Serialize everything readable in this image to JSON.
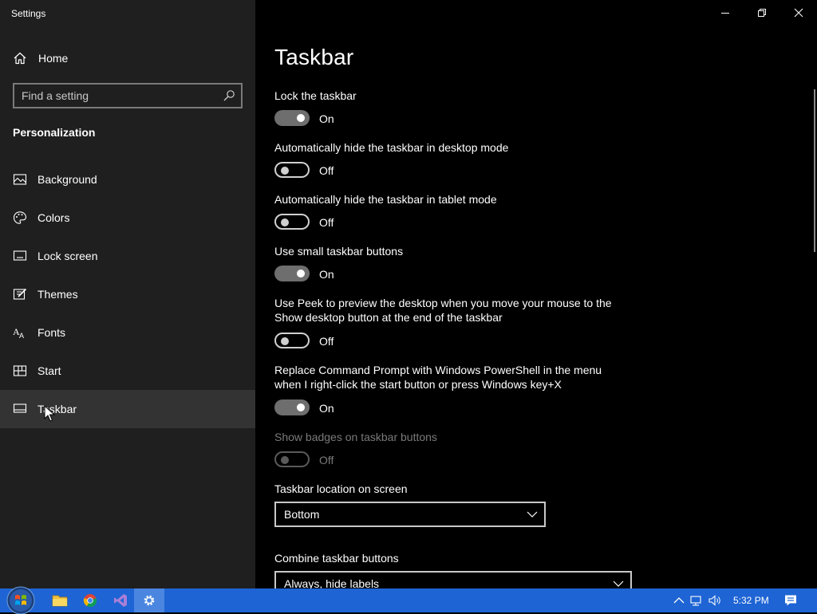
{
  "window": {
    "title": "Settings",
    "minimize_icon": "minimize-icon",
    "maximize_icon": "restore-icon",
    "close_icon": "close-icon"
  },
  "sidebar": {
    "home_label": "Home",
    "search": {
      "placeholder": "Find a setting",
      "icon": "search-icon"
    },
    "section_title": "Personalization",
    "items": [
      {
        "label": "Background",
        "icon": "image-icon"
      },
      {
        "label": "Colors",
        "icon": "palette-icon"
      },
      {
        "label": "Lock screen",
        "icon": "lock-screen-icon"
      },
      {
        "label": "Themes",
        "icon": "paintbrush-icon"
      },
      {
        "label": "Fonts",
        "icon": "font-icon"
      },
      {
        "label": "Start",
        "icon": "start-menu-icon"
      },
      {
        "label": "Taskbar",
        "icon": "taskbar-icon",
        "selected": true
      }
    ]
  },
  "main": {
    "title": "Taskbar",
    "settings": [
      {
        "label": "Lock the taskbar",
        "state": "On",
        "on": true
      },
      {
        "label": "Automatically hide the taskbar in desktop mode",
        "state": "Off",
        "on": false
      },
      {
        "label": "Automatically hide the taskbar in tablet mode",
        "state": "Off",
        "on": false
      },
      {
        "label": "Use small taskbar buttons",
        "state": "On",
        "on": true
      },
      {
        "label": "Use Peek to preview the desktop when you move your mouse to the Show desktop button at the end of the taskbar",
        "state": "Off",
        "on": false
      },
      {
        "label": "Replace Command Prompt with Windows PowerShell in the menu when I right-click the start button or press Windows key+X",
        "state": "On",
        "on": true
      },
      {
        "label": "Show badges on taskbar buttons",
        "state": "Off",
        "on": false,
        "disabled": true
      }
    ],
    "location": {
      "label": "Taskbar location on screen",
      "value": "Bottom"
    },
    "combine": {
      "label": "Combine taskbar buttons",
      "value": "Always, hide labels"
    }
  },
  "taskbar": {
    "apps": [
      "file-explorer-icon",
      "chrome-icon",
      "visual-studio-icon",
      "settings-gear-icon"
    ],
    "time": "5:32 PM",
    "tray_icons": [
      "chevron-up-icon",
      "network-icon",
      "volume-icon",
      "action-center-icon"
    ]
  },
  "colors": {
    "sidebar_bg": "#1f1f1f",
    "main_bg": "#000000",
    "taskbar_bg": "#1e64d4",
    "selected_bg": "#333333"
  }
}
